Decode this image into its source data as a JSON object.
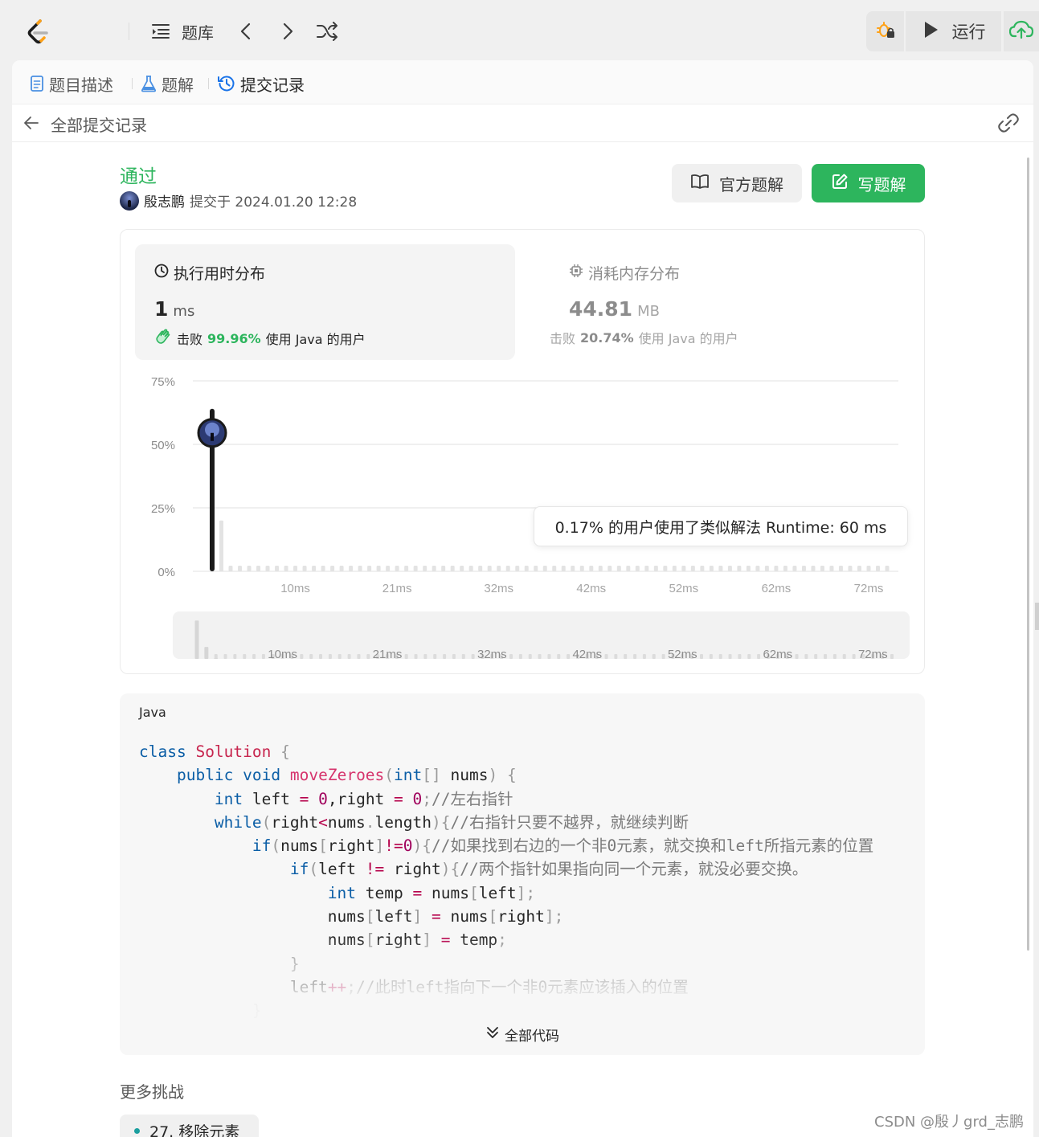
{
  "topbar": {
    "problem_bank_label": "题库",
    "run_label": "运行"
  },
  "tabs": [
    {
      "label": "题目描述"
    },
    {
      "label": "题解"
    },
    {
      "label": "提交记录"
    }
  ],
  "back": {
    "label": "全部提交记录"
  },
  "submission": {
    "status": "通过",
    "author": "殷志鹏",
    "submitted_text": "提交于 2024.01.20 12:28"
  },
  "buttons": {
    "official_solution": "官方题解",
    "write_solution": "写题解"
  },
  "runtime": {
    "title": "执行用时分布",
    "value": "1",
    "unit": "ms",
    "beat_prefix": "击败",
    "beat_pct": "99.96%",
    "beat_suffix": "使用 Java 的用户"
  },
  "memory": {
    "title": "消耗内存分布",
    "value": "44.81",
    "unit": "MB",
    "beat_prefix": "击败",
    "beat_pct": "20.74%",
    "beat_suffix": "使用 Java 的用户"
  },
  "chart_data": {
    "type": "bar",
    "yticks": [
      "75%",
      "50%",
      "25%",
      "0%"
    ],
    "xticks": [
      "10ms",
      "21ms",
      "32ms",
      "42ms",
      "52ms",
      "62ms",
      "72ms"
    ],
    "ylim": [
      0,
      75
    ],
    "x_range_ms": [
      1,
      74
    ],
    "x": [
      1,
      2,
      3
    ],
    "values": [
      64,
      20,
      1
    ],
    "highlight_x": 1,
    "tooltip": "0.17% 的用户使用了类似解法 Runtime: 60 ms"
  },
  "code": {
    "language": "Java",
    "expand_label": "全部代码"
  },
  "more": {
    "title": "更多挑战",
    "items": [
      {
        "label": "27. 移除元素"
      }
    ]
  },
  "watermark": "CSDN @殷丿grd_志鹏",
  "colors": {
    "accent_green": "#2db55d",
    "chart_bar": "#e3e3e3",
    "chart_highlight": "#1a1a1a"
  }
}
